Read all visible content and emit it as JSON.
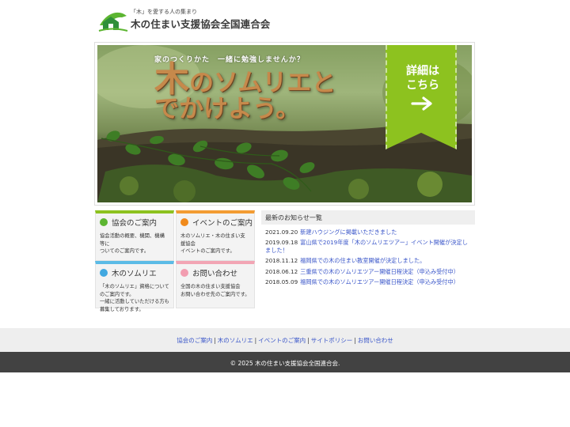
{
  "header": {
    "logo_sub": "「木」を愛する人の集まり",
    "logo_main": "木の住まい支援協会全国連合会"
  },
  "hero": {
    "tagline": "家のつくりかた　一緒に勉強しませんか？",
    "title_big": "木",
    "title_rest1": "のソムリエと",
    "title_line2": "でかけよう。",
    "ribbon_text": "詳細は\nこちら",
    "colors": {
      "ribbon": "#8dc21f",
      "title": "#c6894b"
    }
  },
  "boxes": [
    {
      "title": "協会のご案内",
      "body": "協会活動の概要、機関、機構等に\nついてのご案内です。",
      "accent": "#8dc21f",
      "dot": "#5cb531"
    },
    {
      "title": "イベントのご案内",
      "body": "木のソムリエ・木の住まい支援協会\nイベントのご案内です。",
      "accent": "#f39c33",
      "dot": "#f08a1c"
    },
    {
      "title": "木のソムリエ",
      "body": "「木のソムリエ」資格について\nのご案内です。\n一緒に活動していただける方も\n募集しております。",
      "accent": "#5bbbe6",
      "dot": "#41a8e0"
    },
    {
      "title": "お問い合わせ",
      "body": "全国の木の住まい支援協会\nお問い合わせ先のご案内です。",
      "accent": "#f2a5b4",
      "dot": "#f29db0"
    }
  ],
  "news": {
    "heading": "最新のお知らせ一覧",
    "items": [
      {
        "date": "2021.09.20",
        "text": "新建ハウジングに掲載いただきました"
      },
      {
        "date": "2019.09.18",
        "text": "富山県で2019年度「木のソムリエツアー」イベント開催が決定しました！"
      },
      {
        "date": "2018.11.12",
        "text": "福岡県での木の住まい教室開催が決定しました。"
      },
      {
        "date": "2018.06.12",
        "text": "三重県での木のソムリエツアー開催日程決定（申込み受付中）"
      },
      {
        "date": "2018.05.09",
        "text": "福岡県での木のソムリエツアー開催日程決定（申込み受付中）"
      }
    ]
  },
  "footer": {
    "links": [
      "協会のご案内",
      "木のソムリエ",
      "イベントのご案内",
      "サイトポリシー",
      "お問い合わせ"
    ],
    "separator": "|",
    "copyright": "© 2025 木の住まい支援協会全国連合会."
  }
}
